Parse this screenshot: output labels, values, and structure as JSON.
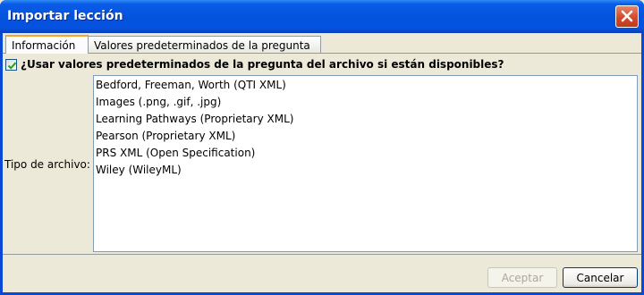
{
  "window": {
    "title": "Importar lección"
  },
  "tabs": [
    {
      "label": "Información",
      "active": true
    },
    {
      "label": "Valores predeterminados de la pregunta",
      "active": false
    }
  ],
  "use_defaults": {
    "checked": true,
    "label": "¿Usar valores predeterminados de la pregunta del archivo si están disponibles?"
  },
  "file_type": {
    "label": "Tipo de archivo:",
    "options": [
      "Bedford, Freeman, Worth (QTI XML)",
      "Images (.png, .gif, .jpg)",
      "Learning Pathways (Proprietary XML)",
      "Pearson (Proprietary XML)",
      "PRS XML (Open Specification)",
      "Wiley (WileyML)"
    ]
  },
  "buttons": {
    "accept": {
      "label": "Aceptar",
      "enabled": false
    },
    "cancel": {
      "label": "Cancelar",
      "enabled": true
    }
  },
  "colors": {
    "title_bar": "#0453dc",
    "active_tab_highlight": "#f0a630",
    "close_button": "#d34a2a",
    "checkmark": "#21a121"
  }
}
